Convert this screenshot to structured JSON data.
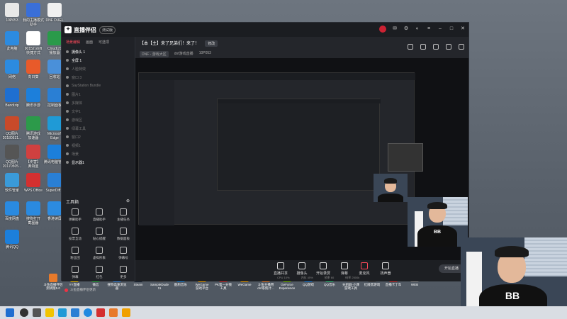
{
  "desktop": {
    "icons": [
      {
        "label": "10P053",
        "color": "#e8e8e8"
      },
      {
        "label": "我的主播模式\n助手",
        "color": "#3a6fd8"
      },
      {
        "label": "DNF DUEL",
        "color": "#f0f0f0"
      },
      {
        "label": "此电脑",
        "color": "#2c8be0"
      },
      {
        "label": "90152 shift\n快捷方式",
        "color": "#fff"
      },
      {
        "label": "CloudUS\n播放器",
        "color": "#2a9a4a"
      },
      {
        "label": "网络",
        "color": "#2c8be0"
      },
      {
        "label": "向日葵",
        "color": "#e85a2a"
      },
      {
        "label": "回收站",
        "color": "#4a90d9"
      },
      {
        "label": "Bandizip",
        "color": "#1f6fd0"
      },
      {
        "label": "腾讯手游",
        "color": "#1c7fdb"
      },
      {
        "label": "控制面板",
        "color": "#2a7fd4"
      },
      {
        "label": "QQ图片\n20180531...",
        "color": "#c84a2a"
      },
      {
        "label": "腾讯游戏\n加速器",
        "color": "#2c9a4a"
      },
      {
        "label": "Microsoft\nEdge",
        "color": "#1f9ad6"
      },
      {
        "label": "QQ图片\n20170505...",
        "color": "#555"
      },
      {
        "label": "【伤害】\n奥特曼",
        "color": "#d04040"
      },
      {
        "label": "腾讯电脑管家",
        "color": "#1c7fdb"
      },
      {
        "label": "软件管家",
        "color": "#3a9ad9"
      },
      {
        "label": "WPS Office",
        "color": "#d43030"
      },
      {
        "label": "SuperDiff...",
        "color": "#2a7fd4"
      },
      {
        "label": "百度网盘",
        "color": "#2a8ae0"
      },
      {
        "label": "搜狗打开\n截图器",
        "color": "#2a8ae0"
      },
      {
        "label": "香港读屏",
        "color": "#2c8be0"
      },
      {
        "label": "腾讯QQ",
        "color": "#1c7fdb"
      }
    ]
  },
  "app": {
    "logo_text": "直播伴侣",
    "edition": "测试版",
    "left_tabs": [
      "场景编辑",
      "画面",
      "可选项"
    ],
    "scenes": [
      {
        "name": "摄像头 1",
        "on": true
      },
      {
        "name": "全屏 1",
        "on": true
      },
      {
        "name": "人脸特效",
        "on": false
      },
      {
        "name": "窗口 3",
        "on": false
      },
      {
        "name": "SayStation Bundle",
        "on": false
      },
      {
        "name": "图片1",
        "on": false
      },
      {
        "name": "多媒体",
        "on": false
      },
      {
        "name": "文字1",
        "on": false
      },
      {
        "name": "游戏区",
        "on": false
      },
      {
        "name": "绿幕工具",
        "on": false
      },
      {
        "name": "窗口2",
        "on": false
      },
      {
        "name": "视频1",
        "on": false
      },
      {
        "name": "场景",
        "on": false
      },
      {
        "name": "显示器1",
        "on": true
      }
    ],
    "tools_header": "工具箱",
    "tools": [
      {
        "label": "弹幕助手"
      },
      {
        "label": "直播助手"
      },
      {
        "label": "主播任务"
      },
      {
        "label": "投票互动"
      },
      {
        "label": "贴心提醒"
      },
      {
        "label": "数据面板"
      },
      {
        "label": "粉丝团"
      },
      {
        "label": "虚拟形象"
      },
      {
        "label": "弹幕号"
      },
      {
        "label": "弹幕"
      },
      {
        "label": "红包"
      },
      {
        "label": "更多"
      }
    ],
    "notice": "斗鱼直播伴侣更新",
    "room_title": "【本【主】来了兄弟们！来了！",
    "room_btn": "修改",
    "room_meta": [
      "DNF - 游戏大区",
      "dnf游戏直播",
      "10P053"
    ],
    "bottom_buttons": [
      "直播共享",
      "摄像头",
      "开始录屏",
      "弹幕",
      "麦克风",
      "扬声器"
    ],
    "stats": [
      "CPU 10%",
      "内存 45%",
      "帧率 60",
      "码率 2500k"
    ],
    "live_btn": "开始直播"
  },
  "apps_row": [
    {
      "label": "斗鱼直播伴侣\n测试版5.0",
      "color": "#e87a2a"
    },
    {
      "label": "YY直播",
      "color": "#f2c400"
    },
    {
      "label": "微信",
      "color": "#2aae3f"
    },
    {
      "label": "搜狗高速浏览器",
      "color": "#3a8ae0"
    },
    {
      "label": "Steam",
      "color": "#1b2838"
    },
    {
      "label": "SampleDude\n11",
      "color": "#555"
    },
    {
      "label": "酷狗音乐",
      "color": "#1f8ae0"
    },
    {
      "label": "WeGame\n游戏平台",
      "color": "#f0a000"
    },
    {
      "label": "PK第一分钱\n工具",
      "color": "#d43030"
    },
    {
      "label": "WeGame",
      "color": "#f0a000"
    },
    {
      "label": "斗鱼主播用\ndnf系统计...",
      "color": "#e87a2a"
    },
    {
      "label": "GeForce\nExperience",
      "color": "#76b900"
    },
    {
      "label": "QQ游戏",
      "color": "#1c7fdb"
    },
    {
      "label": "QQ音乐",
      "color": "#31c27c"
    },
    {
      "label": "分组器·小课\n游戏工具",
      "color": "#555"
    },
    {
      "label": "红陵黑游戏",
      "color": "#444"
    },
    {
      "label": "直播卡丁车",
      "color": "#d43030"
    },
    {
      "label": "WEB",
      "color": "#888"
    }
  ],
  "cam": {
    "shirt_logo": "BB"
  }
}
